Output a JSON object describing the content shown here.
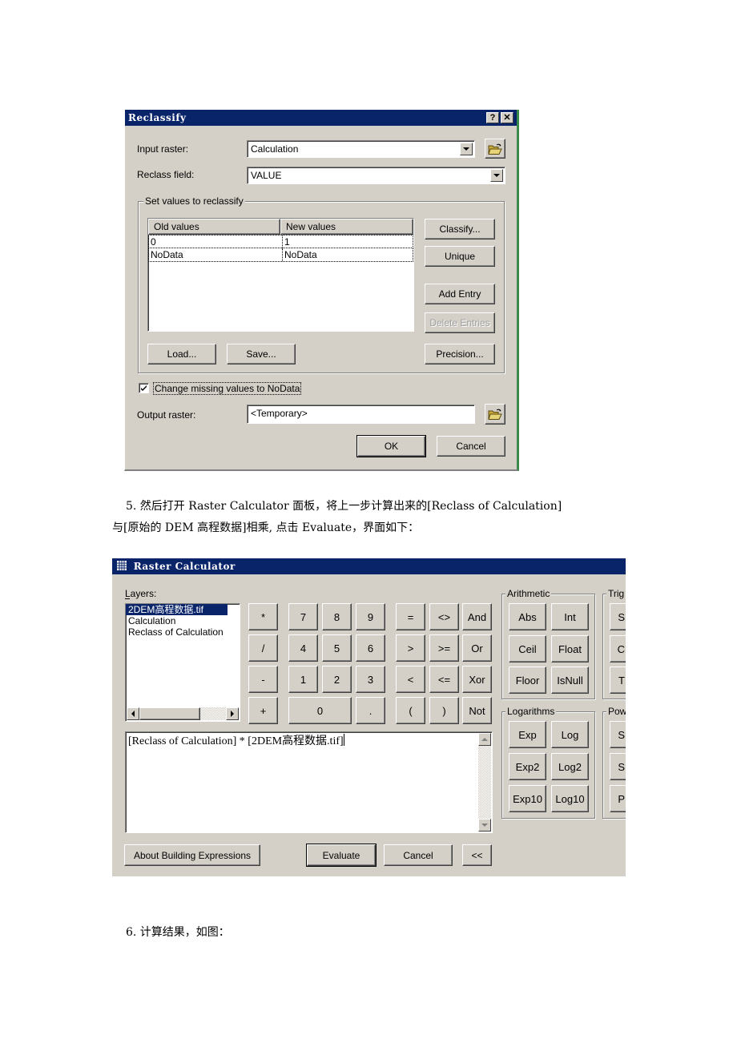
{
  "reclassify": {
    "title": "Reclassify",
    "help_button": "?",
    "close_button": "✕",
    "input_raster_label": "Input raster:",
    "input_raster_value": "Calculation",
    "reclass_field_label": "Reclass field:",
    "reclass_field_value": "VALUE",
    "group_label": "Set values to reclassify",
    "table": {
      "columns": [
        "Old values",
        "New values"
      ],
      "rows": [
        [
          "0",
          "1"
        ],
        [
          "NoData",
          "NoData"
        ]
      ]
    },
    "buttons": {
      "classify": "Classify...",
      "unique": "Unique",
      "add_entry": "Add Entry",
      "delete_entries": "Delete Entries",
      "load": "Load...",
      "save": "Save...",
      "precision": "Precision...",
      "ok": "OK",
      "cancel": "Cancel"
    },
    "checkbox_label": "Change missing values to NoData",
    "checkbox_checked": true,
    "output_raster_label": "Output raster:",
    "output_raster_value": "<Temporary>"
  },
  "doc": {
    "step5_line1": "5. 然后打开 Raster Calculator 面板，将上一步计算出来的[Reclass of Calculation]",
    "step5_line2": "与[原始的 DEM 高程数据]相乘, 点击 Evaluate，界面如下：",
    "step6": "6. 计算结果，如图："
  },
  "raster_calculator": {
    "title": "Raster Calculator",
    "layers_label": "Layers:",
    "layers": [
      "2DEM高程数据.tif",
      "Calculation",
      "Reclass of Calculation"
    ],
    "selected_layer_index": 0,
    "operators": {
      "col1": [
        "*",
        "/",
        "-",
        "+"
      ],
      "digits_row1": [
        "7",
        "8",
        "9"
      ],
      "digits_row2": [
        "4",
        "5",
        "6"
      ],
      "digits_row3": [
        "1",
        "2",
        "3"
      ],
      "zero": "0",
      "dot": ".",
      "compare_row1": [
        "=",
        "<>",
        "And"
      ],
      "compare_row2": [
        ">",
        ">=",
        "Or"
      ],
      "compare_row3": [
        "<",
        "<=",
        "Xor"
      ],
      "compare_row4": [
        "(",
        ")",
        "Not"
      ]
    },
    "arithmetic": {
      "label": "Arithmetic",
      "buttons": [
        "Abs",
        "Int",
        "Ceil",
        "Float",
        "Floor",
        "IsNull"
      ]
    },
    "logarithms": {
      "label": "Logarithms",
      "buttons": [
        "Exp",
        "Log",
        "Exp2",
        "Log2",
        "Exp10",
        "Log10"
      ]
    },
    "trig": {
      "label": "Trig",
      "buttons": [
        "S",
        "C",
        "T"
      ]
    },
    "powers": {
      "label": "Pow",
      "buttons": [
        "S",
        "S",
        "P"
      ]
    },
    "expression": "[Reclass of Calculation] * [2DEM高程数据.tif]",
    "buttons": {
      "about": "About Building Expressions",
      "evaluate": "Evaluate",
      "cancel": "Cancel",
      "collapse": "<<"
    }
  }
}
